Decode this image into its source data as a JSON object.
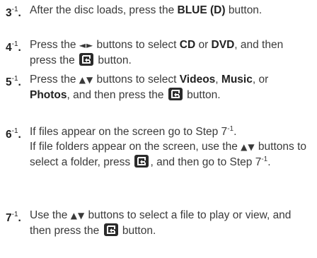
{
  "steps": [
    {
      "num": "3",
      "sup": "-1",
      "t1": "After the disc loads, press the ",
      "b1": "BLUE (D)",
      "t2": " button."
    },
    {
      "num": "4",
      "sup": "-1",
      "t1": "Press the ",
      "arrows": "◄►",
      "t2": " buttons to select ",
      "b1": "CD",
      "t3": " or ",
      "b2": "DVD",
      "t4": ", and then press the ",
      "t5": " button."
    },
    {
      "num": "5",
      "sup": "-1",
      "t1": "Press the ",
      "arrows": "▲▼",
      "t2": " buttons to select ",
      "b1": "Videos",
      "t3": ", ",
      "b2": "Music",
      "t4": ", or ",
      "b3": "Photos",
      "t5": ", and then press the ",
      "t6": " button."
    },
    {
      "num": "6",
      "sup": "-1",
      "t1": "If files appear on the screen go to Step 7",
      "s1": "-1",
      "t2": ".",
      "t3": "If file folders appear on the screen, use the ",
      "arrows": "▲▼",
      "t4": " buttons to select a folder, press ",
      "t5": ", and then go to Step 7",
      "s2": "-1",
      "t6": "."
    },
    {
      "num": "7",
      "sup": "-1",
      "t1": "Use the ",
      "arrows": "▲▼",
      "t2": " buttons to select a file to play or view, and then press the ",
      "t3": " button."
    }
  ]
}
